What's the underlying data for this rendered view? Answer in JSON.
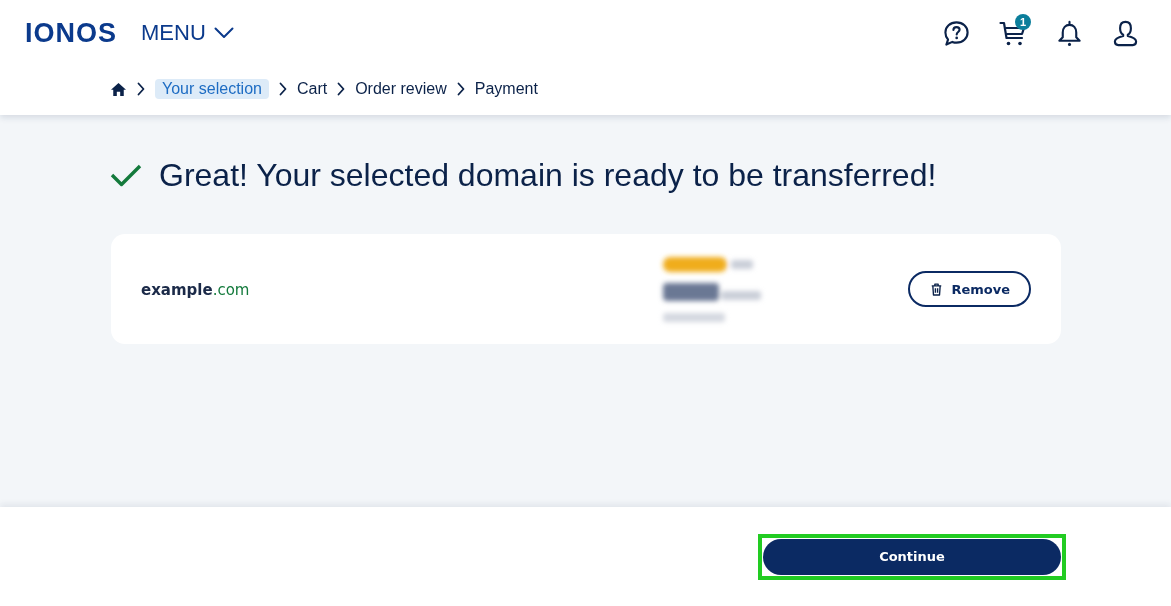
{
  "header": {
    "logo": "IONOS",
    "menu": "MENU",
    "cart_count": "1"
  },
  "breadcrumb": [
    {
      "label": "Your selection",
      "selected": true
    },
    {
      "label": "Cart",
      "selected": false
    },
    {
      "label": "Order review",
      "selected": false
    },
    {
      "label": "Payment",
      "selected": false
    }
  ],
  "message": {
    "title": "Great! Your selected domain is ready to be transferred!"
  },
  "domain": {
    "name": "example",
    "tld": ".com",
    "remove": "Remove"
  },
  "footer": {
    "continue": {
      "label": "Continue",
      "highlighted": true
    }
  }
}
